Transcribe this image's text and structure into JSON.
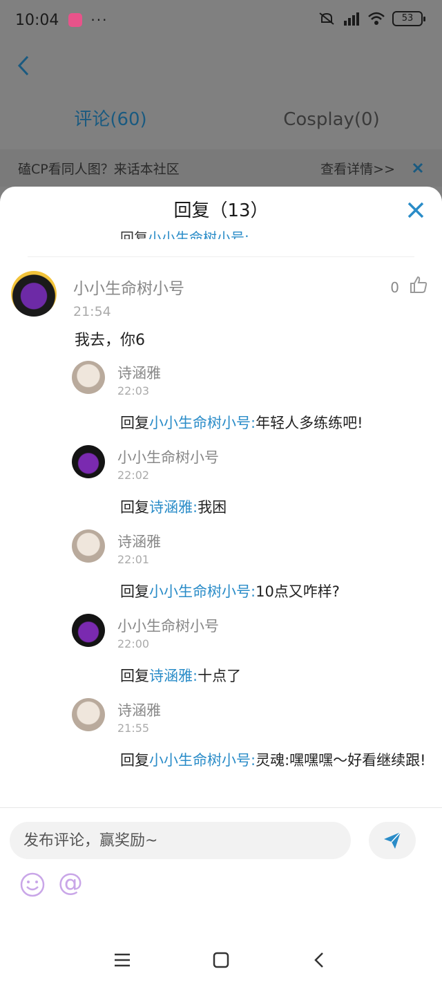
{
  "status": {
    "time": "10:04",
    "dots": "···",
    "battery": "53",
    "icons": [
      "app-notification-icon",
      "mute-icon",
      "signal-icon",
      "wifi-icon",
      "battery-icon"
    ]
  },
  "page": {
    "tabs": [
      {
        "label": "评论(60)",
        "active": true
      },
      {
        "label": "Cosplay(0)",
        "active": false
      }
    ],
    "banner": {
      "text": "磕CP看同人图？来话本社区",
      "link": "查看详情>>"
    }
  },
  "sheet": {
    "title": "回复（13）",
    "main_comment": {
      "name": "小小生命树小号",
      "time": "21:54",
      "text": "我去，你6",
      "likes": "0"
    },
    "reply_prefix": "回复",
    "replies": [
      {
        "name": "诗涵雅",
        "time": "22:03",
        "to": "小小生命树小号:",
        "text": "年轻人多练练吧!"
      },
      {
        "name": "小小生命树小号",
        "time": "22:02",
        "to": "诗涵雅:",
        "text": "我困"
      },
      {
        "name": "诗涵雅",
        "time": "22:01",
        "to": "小小生命树小号:",
        "text": "10点又咋样?"
      },
      {
        "name": "小小生命树小号",
        "time": "22:00",
        "to": "诗涵雅:",
        "text": "十点了"
      },
      {
        "name": "诗涵雅",
        "time": "21:55",
        "to": "小小生命树小号:",
        "text": "灵魂:嘿嘿嘿～好看继续跟!"
      }
    ]
  },
  "input": {
    "placeholder": "发布评论，赢奖励~",
    "at_symbol": "@"
  },
  "colors": {
    "link": "#2a8cc8",
    "accent": "#2a8cc8",
    "icon_purple": "#c9a6e8"
  }
}
